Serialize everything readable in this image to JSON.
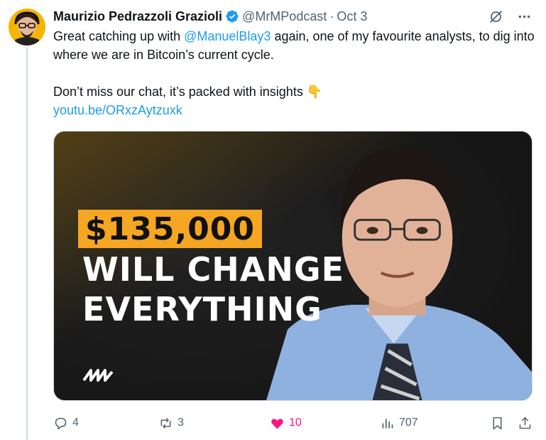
{
  "tweet": {
    "author_name": "Maurizio Pedrazzoli Grazioli",
    "handle": "@MrMPodcast",
    "separator": "·",
    "time": "Oct 3",
    "text_line1_start": "Great catching up with ",
    "mention": "@ManuelBlay3",
    "text_line1_end": " again, one of my favourite analysts, to dig into where we are in Bitcoin’s current cycle.",
    "text_para2": "Don’t miss our chat, it’s packed with insights 👇",
    "link": "youtu.be/ORxzAytzuxk"
  },
  "media": {
    "price": "$135,000",
    "headline_line1": "WILL CHANGE",
    "headline_line2": "EVERYTHING"
  },
  "actions": {
    "replies": "4",
    "reposts": "3",
    "likes": "10",
    "views": "707"
  },
  "colors": {
    "accent": "#1d9bf0",
    "like": "#f91880",
    "price_bg": "#f5a623"
  }
}
